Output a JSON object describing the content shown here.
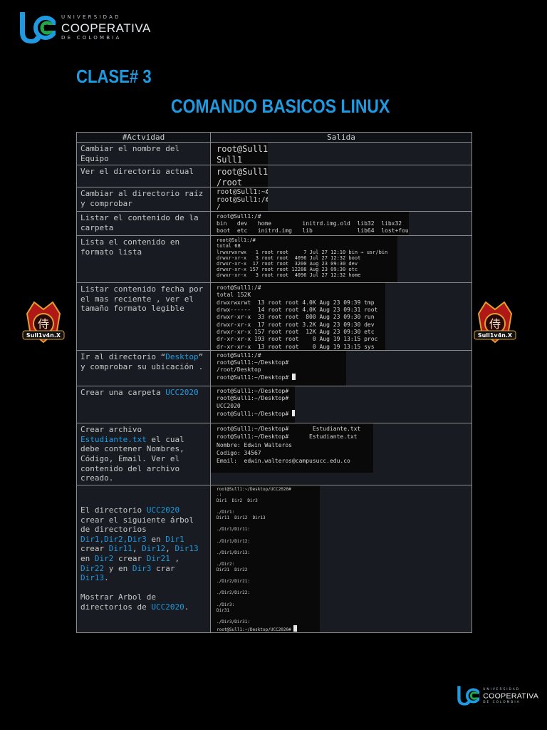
{
  "logo": {
    "line1": "UNIVERSIDAD",
    "line2": "COOPERATIVA",
    "line3": "DE COLOMBIA",
    "mark_colors": [
      "#1f9ae0",
      "#1ea84a"
    ]
  },
  "titles": {
    "clase": "CLASE# 3",
    "main": "COMANDO BASICOS LINUX"
  },
  "badge": {
    "text": "Sull1v4n.X",
    "glyph": "侍"
  },
  "table": {
    "headers": [
      "#Actvidad",
      "Salida"
    ],
    "rows": [
      {
        "activity_parts": [
          {
            "t": "Cambiar el nombre del Equipo"
          }
        ],
        "output": [
          "root@Sull1:",
          "Sull1"
        ]
      },
      {
        "activity_parts": [
          {
            "t": "Ver el directorio actual"
          }
        ],
        "output": [
          "root@Sull1:",
          "/root"
        ]
      },
      {
        "activity_parts": [
          {
            "t": "Cambiar al directorio raíz y comprobar"
          }
        ],
        "output": [
          "root@Sull1:~#",
          "root@Sull1:/#",
          "/"
        ]
      },
      {
        "activity_parts": [
          {
            "t": "Listar el contenido de la carpeta"
          }
        ],
        "output": [
          "root@Sull1:/#",
          "bin   dev   home         initrd.img.old  lib32  libx32",
          "boot  etc   initrd.img   lib             lib64  lost+foun"
        ]
      },
      {
        "activity_parts": [
          {
            "t": "Lista el contenido en formato lista"
          }
        ],
        "output": [
          "root@Sull1:/#",
          "total 68",
          "lrwxrwxrwx   1 root root     7 Jul 27 12:10 bin → usr/bin",
          "drwxr-xr-x   3 root root  4096 Jul 27 12:32 boot",
          "drwxr-xr-x  17 root root  3200 Aug 23 09:30 dev",
          "drwxr-xr-x 157 root root 12288 Aug 23 09:30 etc",
          "drwxr-xr-x   3 root root  4096 Jul 27 12:32 home"
        ]
      },
      {
        "activity_parts": [
          {
            "t": "Listar contenido fecha por el mas reciente , ver el tamaño formato legible"
          }
        ],
        "output": [
          "root@Sull1:/#",
          "total 152K",
          "drwxrwxrwt  13 root root 4.0K Aug 23 09:39 tmp",
          "drwx------  14 root root 4.0K Aug 23 09:31 root",
          "drwxr-xr-x  33 root root  800 Aug 23 09:30 run",
          "drwxr-xr-x  17 root root 3.2K Aug 23 09:30 dev",
          "drwxr-xr-x 157 root root  12K Aug 23 09:30 etc",
          "dr-xr-xr-x 193 root root    0 Aug 19 13:15 proc",
          "dr-xr-xr-x  13 root root    0 Aug 19 13:15 sys"
        ]
      },
      {
        "activity_parts": [
          {
            "t": "Ir al directorio “"
          },
          {
            "t": "Desktop",
            "hl": true
          },
          {
            "t": "” y comprobar su ubicación ."
          }
        ],
        "output": [
          "root@Sull1:/#",
          "root@Sull1:~/Desktop#",
          "/root/Desktop",
          "root@Sull1:~/Desktop# "
        ]
      },
      {
        "activity_parts": [
          {
            "t": "Crear una carpeta "
          },
          {
            "t": "UCC2020",
            "hl": true
          }
        ],
        "output": [
          "root@Sull1:~/Desktop#",
          "root@Sull1:~/Desktop#",
          "UCC2020",
          "root@Sull1:~/Desktop# "
        ]
      },
      {
        "activity_parts": [
          {
            "t": "Crear archivo "
          },
          {
            "t": "Estudiante.txt",
            "hl": true
          },
          {
            "t": " el cual debe contener Nombres, Código, Email. Ver el contenido del archivo creado."
          }
        ],
        "output": [
          "root@Sull1:~/Desktop#       Estudiante.txt",
          "root@Sull1:~/Desktop#      Estudiante.txt",
          "Nombre: Edwin Walteros",
          "Codigo: 34567",
          "Email:  edwin.walteros@campusucc.edu.co"
        ]
      },
      {
        "activity_parts": [
          {
            "t": "El directorio "
          },
          {
            "t": "UCC2020",
            "hl": true
          },
          {
            "t": " crear el siguiente árbol de directorios "
          },
          {
            "t": "Dir1,Dir2,Dir3",
            "hl": true
          },
          {
            "t": " en "
          },
          {
            "t": "Dir1",
            "hl": true
          },
          {
            "t": " crear "
          },
          {
            "t": "Dir11",
            "hl": true
          },
          {
            "t": ", "
          },
          {
            "t": "Dir12",
            "hl": true
          },
          {
            "t": ", "
          },
          {
            "t": "Dir13",
            "hl": true
          },
          {
            "t": " en "
          },
          {
            "t": "Dir2",
            "hl": true
          },
          {
            "t": " crear "
          },
          {
            "t": "Dir21",
            "hl": true
          },
          {
            "t": " , "
          },
          {
            "t": "Dir22",
            "hl": true
          },
          {
            "t": " y en "
          },
          {
            "t": "Dir3",
            "hl": true
          },
          {
            "t": " crar "
          },
          {
            "t": "Dir13",
            "hl": true
          },
          {
            "t": ".\n\nMostrar Arbol de directorios de "
          },
          {
            "t": "UCC2020",
            "hl": true
          },
          {
            "t": "."
          }
        ],
        "output": [
          "root@Sull1:~/Desktop/UCC2020#",
          ".:",
          "Dir1  Dir2  Dir3",
          "",
          "./Dir1:",
          "Dir11  Dir12  Dir13",
          "",
          "./Dir1/Dir11:",
          "",
          "./Dir1/Dir12:",
          "",
          "./Dir1/Dir13:",
          "",
          "./Dir2:",
          "Dir21  Dir22",
          "",
          "./Dir2/Dir21:",
          "",
          "./Dir2/Dir22:",
          "",
          "./Dir3:",
          "Dir31",
          "",
          "./Dir3/Dir31:",
          "root@Sull1:~/Desktop/UCC2020# "
        ]
      }
    ]
  }
}
